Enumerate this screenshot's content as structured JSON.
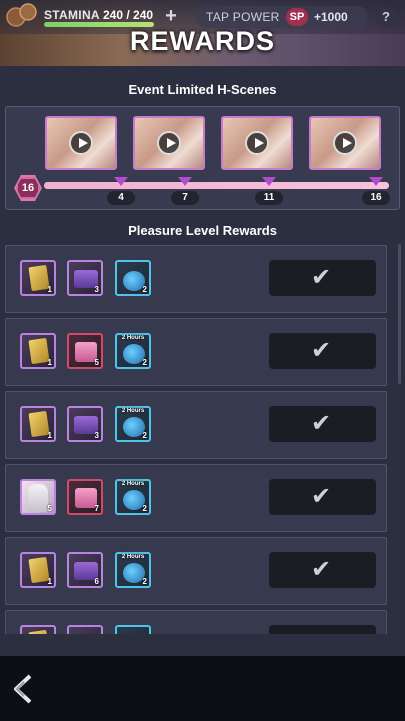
{
  "topbar": {
    "stamina_label": "STAMINA",
    "stamina_value": "240 / 240",
    "stamina_fraction": 1.0,
    "plus_label": "+",
    "tap_power_label": "TAP POWER",
    "sp_label": "SP",
    "tap_power_value": "+1000",
    "help_label": "?"
  },
  "title": "REWARDS",
  "scenes": {
    "title": "Event Limited H-Scenes",
    "thumbnails": [
      "scene-1",
      "scene-2",
      "scene-3",
      "scene-4"
    ],
    "current_level": "16",
    "progress_fraction": 1.0,
    "markers": [
      "4",
      "7",
      "11",
      "16"
    ]
  },
  "rewards": {
    "title": "Pleasure Level Rewards",
    "rows": [
      {
        "items": [
          {
            "type": "gold",
            "count": "1"
          },
          {
            "type": "chest",
            "count": "3"
          },
          {
            "type": "potion",
            "count": "2",
            "hours": ""
          }
        ]
      },
      {
        "items": [
          {
            "type": "gold",
            "count": "1"
          },
          {
            "type": "pink",
            "count": "5"
          },
          {
            "type": "potion",
            "count": "2",
            "hours": "2 Hours"
          }
        ]
      },
      {
        "items": [
          {
            "type": "gold",
            "count": "1"
          },
          {
            "type": "chest",
            "count": "3"
          },
          {
            "type": "potion",
            "count": "2",
            "hours": "2 Hours"
          }
        ]
      },
      {
        "items": [
          {
            "type": "char",
            "count": "5"
          },
          {
            "type": "pink",
            "count": "7"
          },
          {
            "type": "potion",
            "count": "2",
            "hours": "2 Hours"
          }
        ]
      },
      {
        "items": [
          {
            "type": "gold",
            "count": "1"
          },
          {
            "type": "chest",
            "count": "6"
          },
          {
            "type": "potion",
            "count": "2",
            "hours": "2 Hours"
          }
        ]
      },
      {
        "items": [
          {
            "type": "gold",
            "count": ""
          },
          {
            "type": "chest",
            "count": ""
          },
          {
            "type": "potion",
            "count": "",
            "hours": ""
          }
        ]
      }
    ],
    "claimed_icon": "check-icon"
  },
  "nav": {
    "back_icon": "back-arrow-icon"
  },
  "colors": {
    "accent": "#c67bd0",
    "progress": "#f0b0d0",
    "level_badge": "#8c2e5a"
  }
}
